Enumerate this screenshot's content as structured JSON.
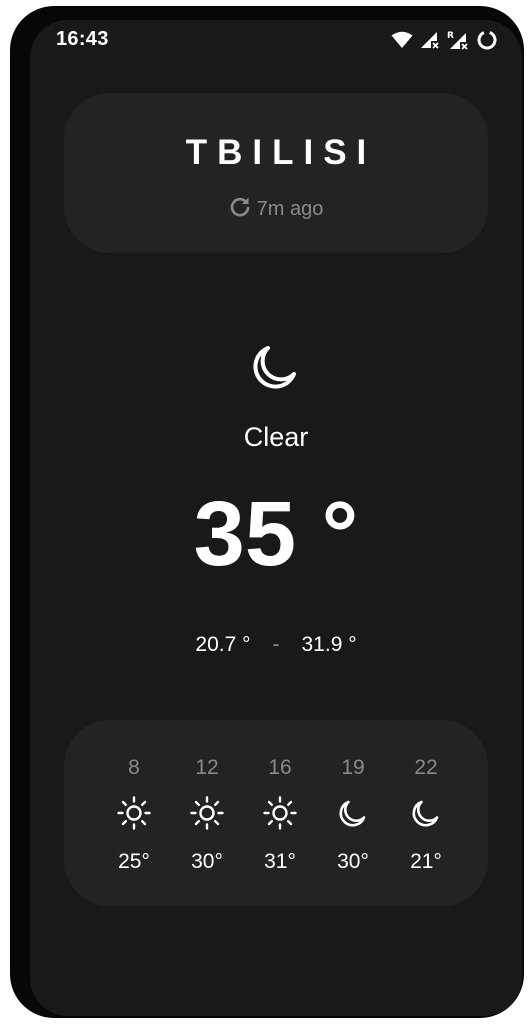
{
  "status_bar": {
    "time": "16:43",
    "icons": [
      "wifi-icon",
      "signal-icon",
      "roaming-signal-icon",
      "battery-ring-icon"
    ]
  },
  "location": {
    "city": "TBILISI",
    "updated": "7m ago",
    "refresh_icon": "refresh-icon"
  },
  "current": {
    "icon": "moon-icon",
    "condition": "Clear",
    "temperature": "35 °",
    "low": "20.7 °",
    "separator": "-",
    "high": "31.9 °"
  },
  "hourly": [
    {
      "hour": "8",
      "icon": "sun-icon",
      "temp": "25°"
    },
    {
      "hour": "12",
      "icon": "sun-icon",
      "temp": "30°"
    },
    {
      "hour": "16",
      "icon": "sun-icon",
      "temp": "31°"
    },
    {
      "hour": "19",
      "icon": "moon-icon",
      "temp": "30°"
    },
    {
      "hour": "22",
      "icon": "moon-icon",
      "temp": "21°"
    }
  ],
  "colors": {
    "background": "#191919",
    "card": "#232323",
    "text": "#ffffff",
    "muted": "#8a8a8a"
  }
}
